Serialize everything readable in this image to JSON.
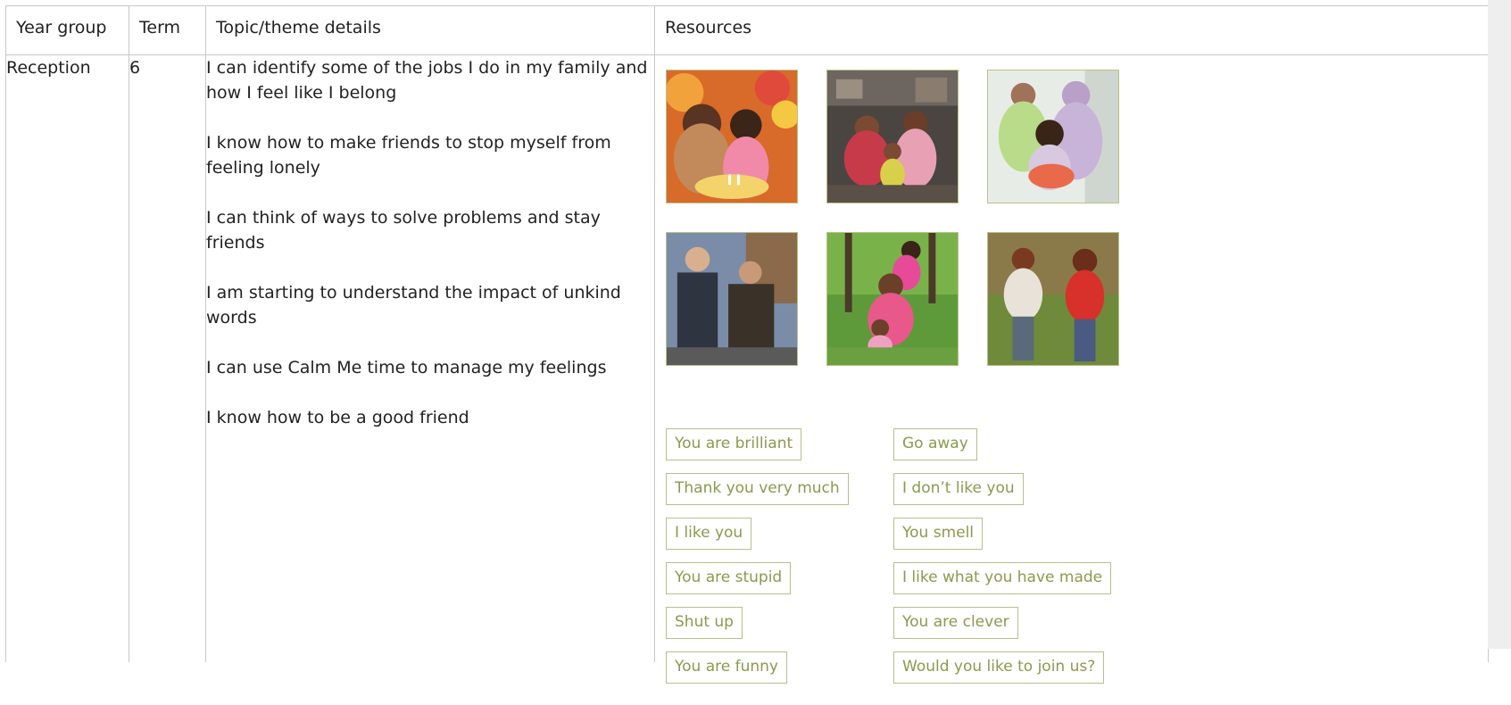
{
  "table": {
    "headers": {
      "year_group": "Year group",
      "term": "Term",
      "topic": "Topic/theme details",
      "resources": "Resources"
    },
    "row": {
      "year_group": "Reception",
      "term": "6",
      "topics": [
        "I can identify some of the jobs I do in my family and how I feel like I belong",
        "I know how to make friends to stop myself from feeling lonely",
        "I can think of ways to solve problems and stay friends",
        "I am starting to understand the impact of unkind words",
        "I can use Calm Me time to manage my feelings",
        "I know how to be a good friend"
      ],
      "phrases_left": [
        "You are brilliant",
        "Thank you very much",
        "I like you",
        "You are stupid",
        "Shut up",
        "You are funny"
      ],
      "phrases_right": [
        "Go away",
        "I don’t like you",
        "You smell",
        "I like what you have made",
        "You are clever",
        "Would you like to join us?"
      ]
    }
  },
  "colors": {
    "phrase_text": "#8a9a4e",
    "phrase_border": "#b5c08b",
    "grid_line": "#c8c8c8"
  }
}
